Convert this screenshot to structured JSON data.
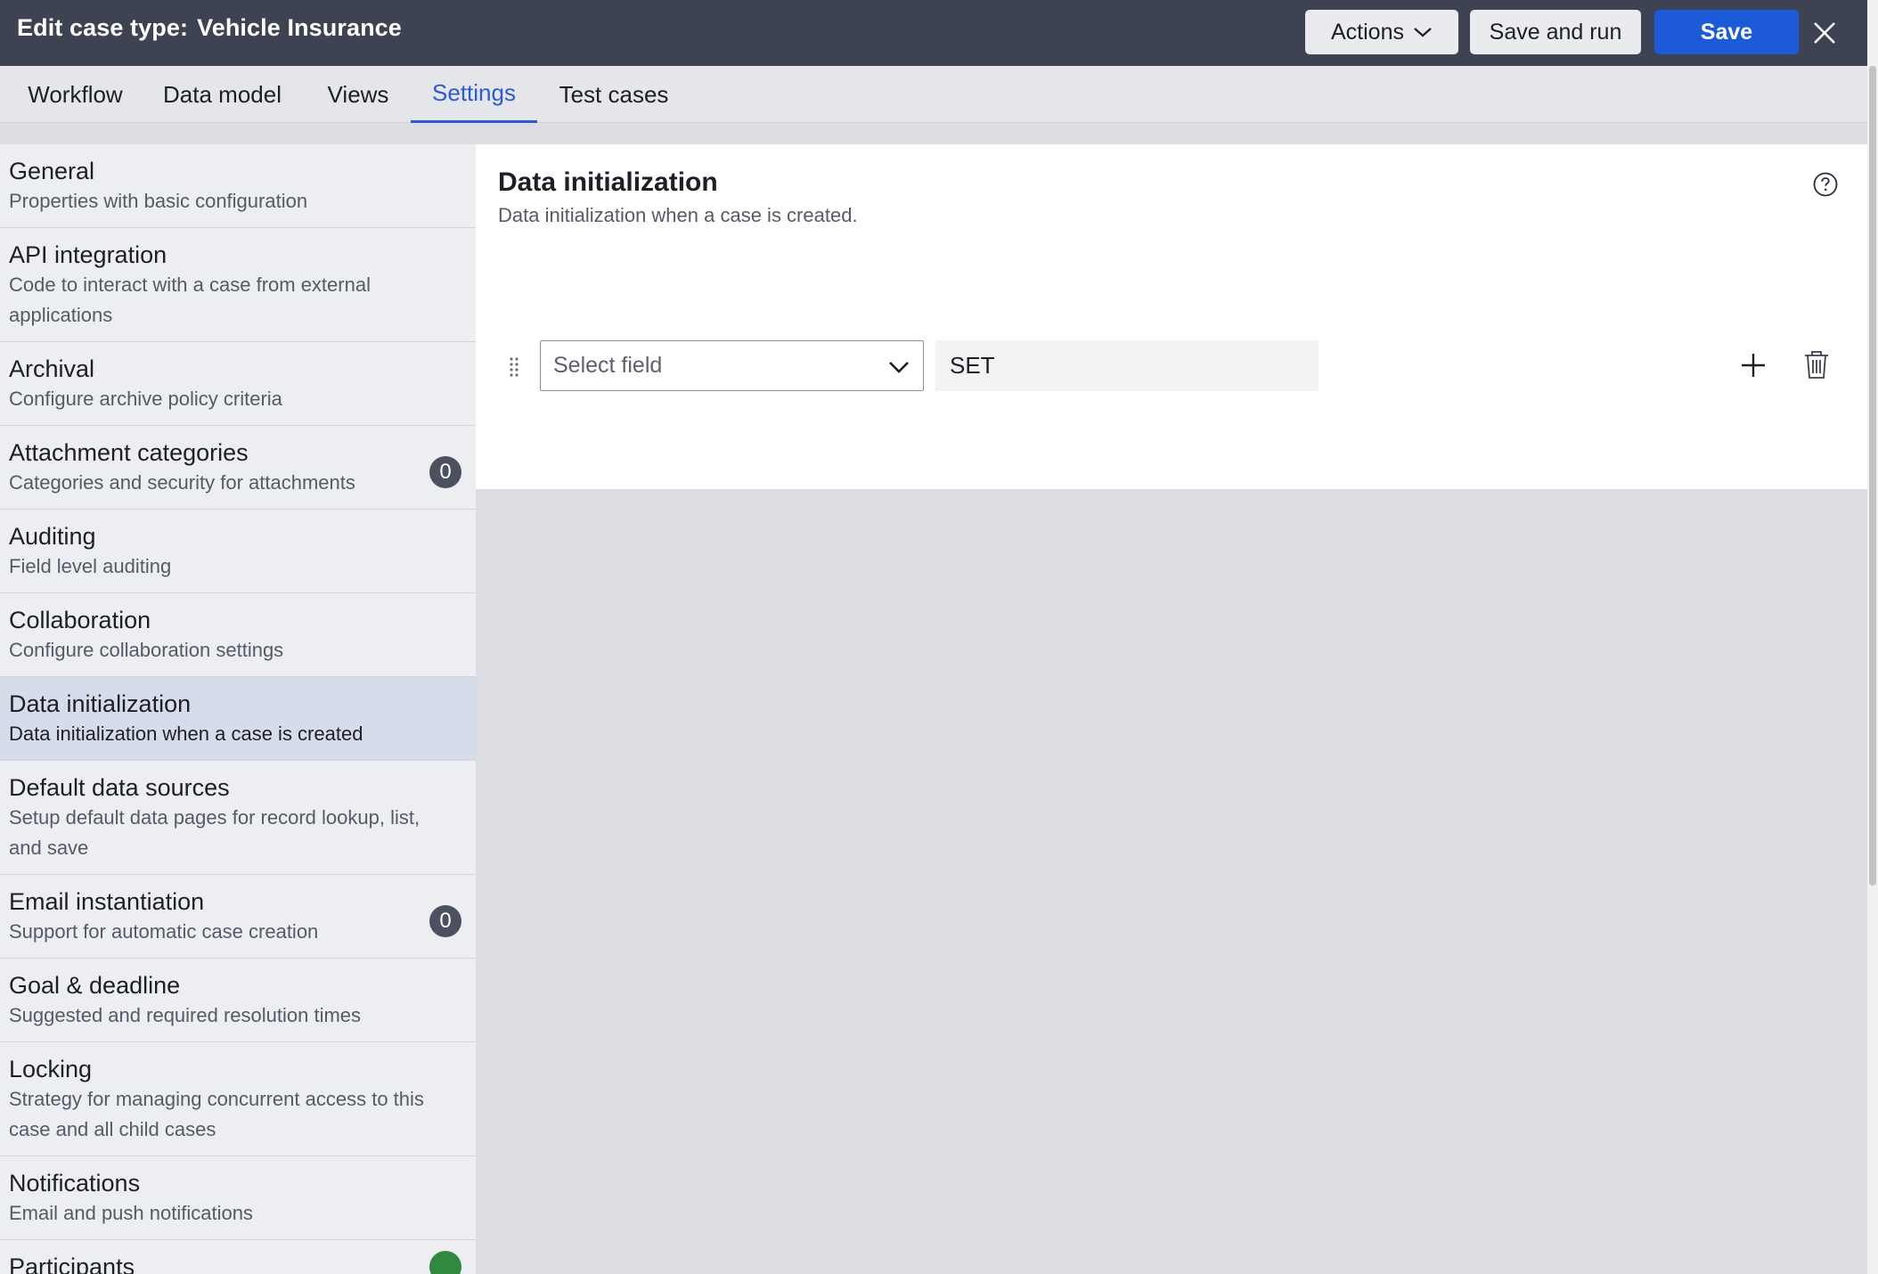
{
  "header": {
    "title_prefix": "Edit case type:",
    "title_name": "Vehicle Insurance",
    "actions_label": "Actions",
    "save_and_run_label": "Save and run",
    "save_label": "Save",
    "close_icon": "close-icon"
  },
  "tabs": [
    {
      "label": "Workflow"
    },
    {
      "label": "Data model"
    },
    {
      "label": "Views"
    },
    {
      "label": "Settings",
      "active": true
    },
    {
      "label": "Test cases"
    }
  ],
  "sidebar": {
    "items": [
      {
        "title": "General",
        "desc": "Properties with basic configuration"
      },
      {
        "title": "API integration",
        "desc": "Code to interact with a case from external applications"
      },
      {
        "title": "Archival",
        "desc": "Configure archive policy criteria"
      },
      {
        "title": "Attachment categories",
        "desc": "Categories and security for attachments",
        "badge": "0"
      },
      {
        "title": "Auditing",
        "desc": "Field level auditing"
      },
      {
        "title": "Collaboration",
        "desc": "Configure collaboration settings"
      },
      {
        "title": "Data initialization",
        "desc": "Data initialization when a case is created",
        "active": true
      },
      {
        "title": "Default data sources",
        "desc": "Setup default data pages for record lookup, list, and save"
      },
      {
        "title": "Email instantiation",
        "desc": "Support for automatic case creation",
        "badge": "0"
      },
      {
        "title": "Goal & deadline",
        "desc": "Suggested and required resolution times"
      },
      {
        "title": "Locking",
        "desc": "Strategy for managing concurrent access to this case and all child cases"
      },
      {
        "title": "Notifications",
        "desc": "Email and push notifications"
      },
      {
        "title": "Participants",
        "desc": ""
      }
    ]
  },
  "panel": {
    "title": "Data initialization",
    "subtitle": "Data initialization when a case is created.",
    "row": {
      "select_placeholder": "Select field",
      "set_value": "SET"
    }
  },
  "colors": {
    "header_bg": "#3e4353",
    "primary": "#1c5ad8",
    "active_tab": "#2b5ad6",
    "active_item_bg": "#d6dcea"
  }
}
